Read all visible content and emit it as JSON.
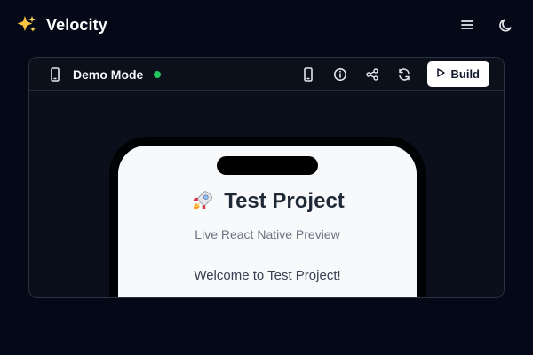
{
  "app": {
    "name": "Velocity",
    "icon": "sparkles-icon",
    "accent": "#f6c343"
  },
  "header": {
    "menu_icon": "menu-icon",
    "theme_icon": "moon-icon"
  },
  "panel": {
    "mode_title": "Demo Mode",
    "mode_icon": "phone-icon",
    "status_color": "#22c55e",
    "actions": [
      {
        "name": "device-icon"
      },
      {
        "name": "info-icon"
      },
      {
        "name": "share-icon"
      },
      {
        "name": "refresh-icon"
      }
    ],
    "build_label": "Build",
    "build_icon": "play-icon"
  },
  "preview": {
    "project_icon": "rocket-icon",
    "project_title": "Test Project",
    "subtitle": "Live React Native Preview",
    "welcome_text": "Welcome to Test Project!"
  }
}
